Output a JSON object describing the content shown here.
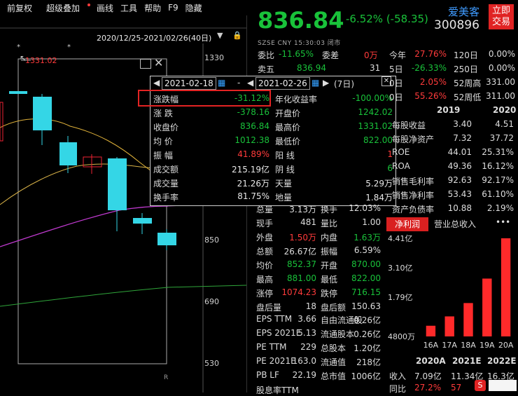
{
  "menu": {
    "items": [
      "前复权",
      "超级叠加",
      "画线",
      "工具",
      "帮助",
      "F9",
      "隐藏"
    ]
  },
  "chart": {
    "range": "2020/12/25-2021/02/26(40日)",
    "high_marker": "1331.02",
    "axis_labels": [
      "1330",
      "850",
      "690",
      "530"
    ],
    "star": "*",
    "corner_mark": "R"
  },
  "popup": {
    "start_date": "2021-02-18",
    "end_date": "2021-02-26",
    "dash": "-",
    "days": "(7日)",
    "left_labels": [
      "涨跌幅",
      "涨  跌",
      "收盘价",
      "均  价",
      "振  幅",
      "成交额",
      "成交量",
      "换手率"
    ],
    "left_values": [
      "-31.12%",
      "-378.16",
      "836.84",
      "1012.38",
      "41.89%",
      "215.19亿",
      "21.26万",
      "81.75%"
    ],
    "right_labels": [
      "年化收益率",
      "开盘价",
      "最高价",
      "最低价",
      "阳  线",
      "阴  线",
      "天量",
      "地量"
    ],
    "right_values": [
      "-100.00%",
      "1242.02",
      "1331.02",
      "822.00",
      "1",
      "6",
      "5.29万",
      "1.84万"
    ]
  },
  "quote": {
    "price": "836.84",
    "change": "-6.52% (-58.35)",
    "name": "爱美客",
    "code": "300896",
    "trade_button": [
      "立即",
      "交易"
    ],
    "meta": "SZSE  CNY  15:30:03  闭市"
  },
  "order_book": {
    "rows": [
      {
        "l1": "委比",
        "v1": "-11.65%",
        "l2": "委差",
        "v2": "0万"
      },
      {
        "l1": "卖五",
        "v1": "836.94",
        "l2": "",
        "v2": "31"
      }
    ]
  },
  "period_stats": [
    {
      "l": "今年",
      "v": "27.76%",
      "l2": "120日",
      "v2": "0.00%"
    },
    {
      "l": "5日",
      "v": "-26.33%",
      "l2": "250日",
      "v2": "0.00%"
    },
    {
      "l": "0日",
      "v": "2.05%",
      "l2": "52周高",
      "v2": "331.00"
    },
    {
      "l": "0日",
      "v": "55.26%",
      "l2": "52周低",
      "v2": "311.00"
    }
  ],
  "fin_table": {
    "years": [
      "2019",
      "2020"
    ],
    "rows": [
      {
        "label": "每股收益",
        "a": "3.40",
        "b": "4.51"
      },
      {
        "label": "每股净资产",
        "a": "7.32",
        "b": "37.72"
      },
      {
        "label": "ROE",
        "a": "44.01",
        "b": "25.31%"
      },
      {
        "label": "ROA",
        "a": "49.36",
        "b": "16.12%"
      },
      {
        "label": "销售毛利率",
        "a": "92.63",
        "b": "92.17%"
      },
      {
        "label": "销售净利率",
        "a": "53.43",
        "b": "61.10%"
      },
      {
        "label": "资产负债率",
        "a": "10.88",
        "b": "2.19%"
      }
    ]
  },
  "trade_stats": [
    {
      "l1": "总量",
      "v1": "3.13万",
      "l2": "换手",
      "v2": "12.03%"
    },
    {
      "l1": "现手",
      "v1": "481",
      "l2": "量比",
      "v2": "1.00"
    },
    {
      "l1": "外盘",
      "v1": "1.50万",
      "l2": "内盘",
      "v2": "1.63万"
    },
    {
      "l1": "总额",
      "v1": "26.67亿",
      "l2": "振幅",
      "v2": "6.59%"
    },
    {
      "l1": "均价",
      "v1": "852.37",
      "l2": "开盘",
      "v2": "870.00"
    },
    {
      "l1": "最高",
      "v1": "881.00",
      "l2": "最低",
      "v2": "822.00"
    },
    {
      "l1": "涨停",
      "v1": "1074.23",
      "l2": "跌停",
      "v2": "716.15"
    },
    {
      "l1": "盘后量",
      "v1": "18",
      "l2": "盘后额",
      "v2": "150.63"
    }
  ],
  "fundamentals": [
    {
      "l1": "EPS TTM",
      "v1": "3.66",
      "l2": "自由流通股",
      "v2": "0.26亿"
    },
    {
      "l1": "EPS 2021E",
      "v1": "5.13",
      "l2": "流通股本",
      "v2": "0.26亿"
    },
    {
      "l1": "PE TTM",
      "v1": "229",
      "l2": "总股本",
      "v2": "1.20亿"
    },
    {
      "l1": "PE 2021E",
      "v1": "163.0",
      "l2": "流通值",
      "v2": "218亿"
    },
    {
      "l1": "PB LF",
      "v1": "22.19",
      "l2": "总市值",
      "v2": "1006亿"
    },
    {
      "l1": "股息率TTM",
      "v1": "",
      "l2": "",
      "v2": ""
    }
  ],
  "profit_tabs": {
    "active": "净利润",
    "other": "营业总收入",
    "more": "•••"
  },
  "chart_data": {
    "type": "bar",
    "categories": [
      "16A",
      "17A",
      "18A",
      "19A",
      "20A"
    ],
    "values": [
      0.48,
      0.9,
      1.5,
      2.6,
      4.41
    ],
    "y_ticks": [
      "4.41亿",
      "3.10亿",
      "1.79亿",
      "4800万"
    ],
    "color": "#ff2a2a"
  },
  "forecast": {
    "headers": [
      "2020A",
      "2021E",
      "2022E"
    ],
    "rows": [
      {
        "label": "收入",
        "v": [
          "7.09亿",
          "11.34亿",
          "16.3亿"
        ]
      },
      {
        "label": "同比",
        "v": [
          "27.2%",
          "57",
          ""
        ]
      }
    ]
  }
}
